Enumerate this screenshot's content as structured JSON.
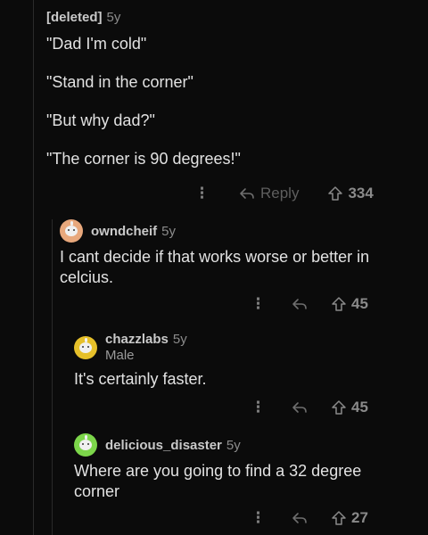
{
  "comments": [
    {
      "author": "[deleted]",
      "age": "5y",
      "body": [
        "\"Dad I'm cold\"",
        "\"Stand in the corner\"",
        "\"But why dad?\"",
        "\"The corner is 90 degrees!\""
      ],
      "reply_label": "Reply",
      "more_label": "⋮",
      "score": "334"
    },
    {
      "author": "owndcheif",
      "age": "5y",
      "avatar_color": "#e8a87c",
      "body": [
        "I cant decide if that works worse or better in celcius."
      ],
      "more_label": "⋮",
      "score": "45"
    },
    {
      "author": "chazzlabs",
      "age": "5y",
      "flair": "Male",
      "avatar_color": "#e6c02a",
      "body": [
        "It's certainly faster."
      ],
      "more_label": "⋮",
      "score": "45"
    },
    {
      "author": "delicious_disaster",
      "age": "5y",
      "avatar_color": "#7cd64a",
      "body": [
        "Where are you going to find a 32 degree corner"
      ],
      "more_label": "⋮",
      "score": "27"
    }
  ]
}
